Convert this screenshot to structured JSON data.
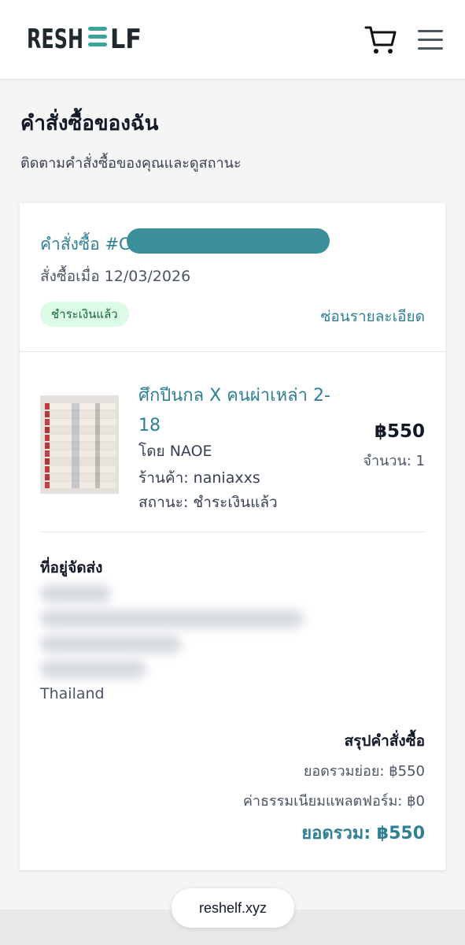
{
  "header": {
    "logo_text": "RESHELF",
    "icons": {
      "cart": "cart-icon",
      "menu": "hamburger-menu-icon"
    }
  },
  "page": {
    "title": "คำสั่งซื้อของฉัน",
    "subtitle": "ติดตามคำสั่งซื้อของคุณและดูสถานะ"
  },
  "order": {
    "id_label": "คำสั่งซื้อ #C",
    "date_text": "สั่งซื้อเมื่อ 12/03/2026",
    "status_badge": "ชำระเงินแล้ว",
    "toggle_details": "ซ่อนรายละเอียด",
    "item": {
      "title": "ศึกปีนกล X คนผ่าเหล่า 2-18",
      "author": "โดย NAOE",
      "shop": "ร้านค้า: naniaxxs",
      "status": "สถานะ: ชำระเงินแล้ว",
      "price": "฿550",
      "quantity": "จำนวน: 1"
    },
    "address": {
      "heading": "ที่อยู่จัดส่ง",
      "country": "Thailand"
    },
    "summary": {
      "heading": "สรุปคำสั่งซื้อ",
      "subtotal": "ยอดรวมย่อย: ฿550",
      "platform_fee": "ค่าธรรมเนียมแพลตฟอร์ม: ฿0",
      "total": "ยอดรวม: ฿550"
    }
  },
  "browser": {
    "url": "reshelf.xyz"
  },
  "colors": {
    "accent": "#2f7f95",
    "logo_dark": "#1f2a2e",
    "logo_teal": "#3aa39a",
    "badge_bg": "#dcfce7",
    "badge_text": "#166534"
  }
}
